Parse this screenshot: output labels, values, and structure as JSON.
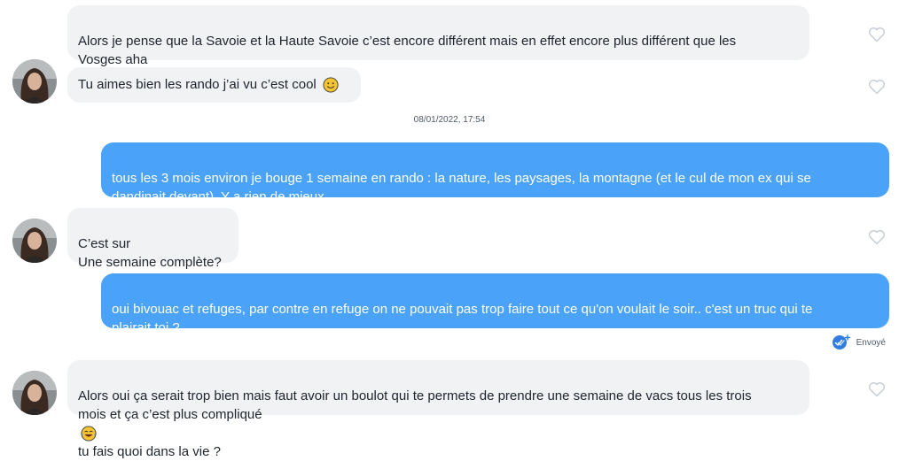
{
  "conversation": {
    "messages": [
      {
        "id": "m1",
        "sender": "them",
        "text": "Alors je pense que la Savoie et la Haute Savoie c’est encore différent mais en effet encore plus différent que les\nVosges aha"
      },
      {
        "id": "m2",
        "sender": "them",
        "text": "Tu aimes bien les rando j’ai vu c’est cool",
        "emoji": "slightly-smiling-face"
      },
      {
        "id": "m3",
        "sender": "me",
        "text": "tous les 3 mois environ je bouge 1 semaine en rando : la nature, les paysages, la montagne (et  le cul de mon ex qui se\ndandinait devant). Y a rien de mieux"
      },
      {
        "id": "m4",
        "sender": "them",
        "text": "C’est sur\nUne semaine complète?"
      },
      {
        "id": "m5",
        "sender": "me",
        "text": "oui bivouac et refuges, par contre en refuge on ne pouvait pas trop faire tout ce qu'on voulait le soir.. c'est un truc qui te\nplairait toi ?"
      },
      {
        "id": "m6",
        "sender": "them",
        "text_before": "Alors oui ça serait trop bien mais faut avoir un boulot qui te permets de prendre une semaine de vacs tous les trois\nmois et ça c’est plus compliqué",
        "emoji": "face-with-tears-of-joy",
        "text_after": "tu fais quoi dans la vie ?"
      }
    ],
    "timestamp": "08/01/2022, 17:54",
    "delivery_status": "Envoyé"
  },
  "colors": {
    "sent_bubble": "#4aa3f8",
    "received_bubble": "#f0f2f4",
    "heart_outline": "#c9ced6",
    "read_check": "#2f7de0"
  },
  "icons": [
    "heart-icon",
    "double-check-icon",
    "slightly-smiling-face-emoji",
    "face-with-tears-of-joy-emoji",
    "avatar"
  ]
}
